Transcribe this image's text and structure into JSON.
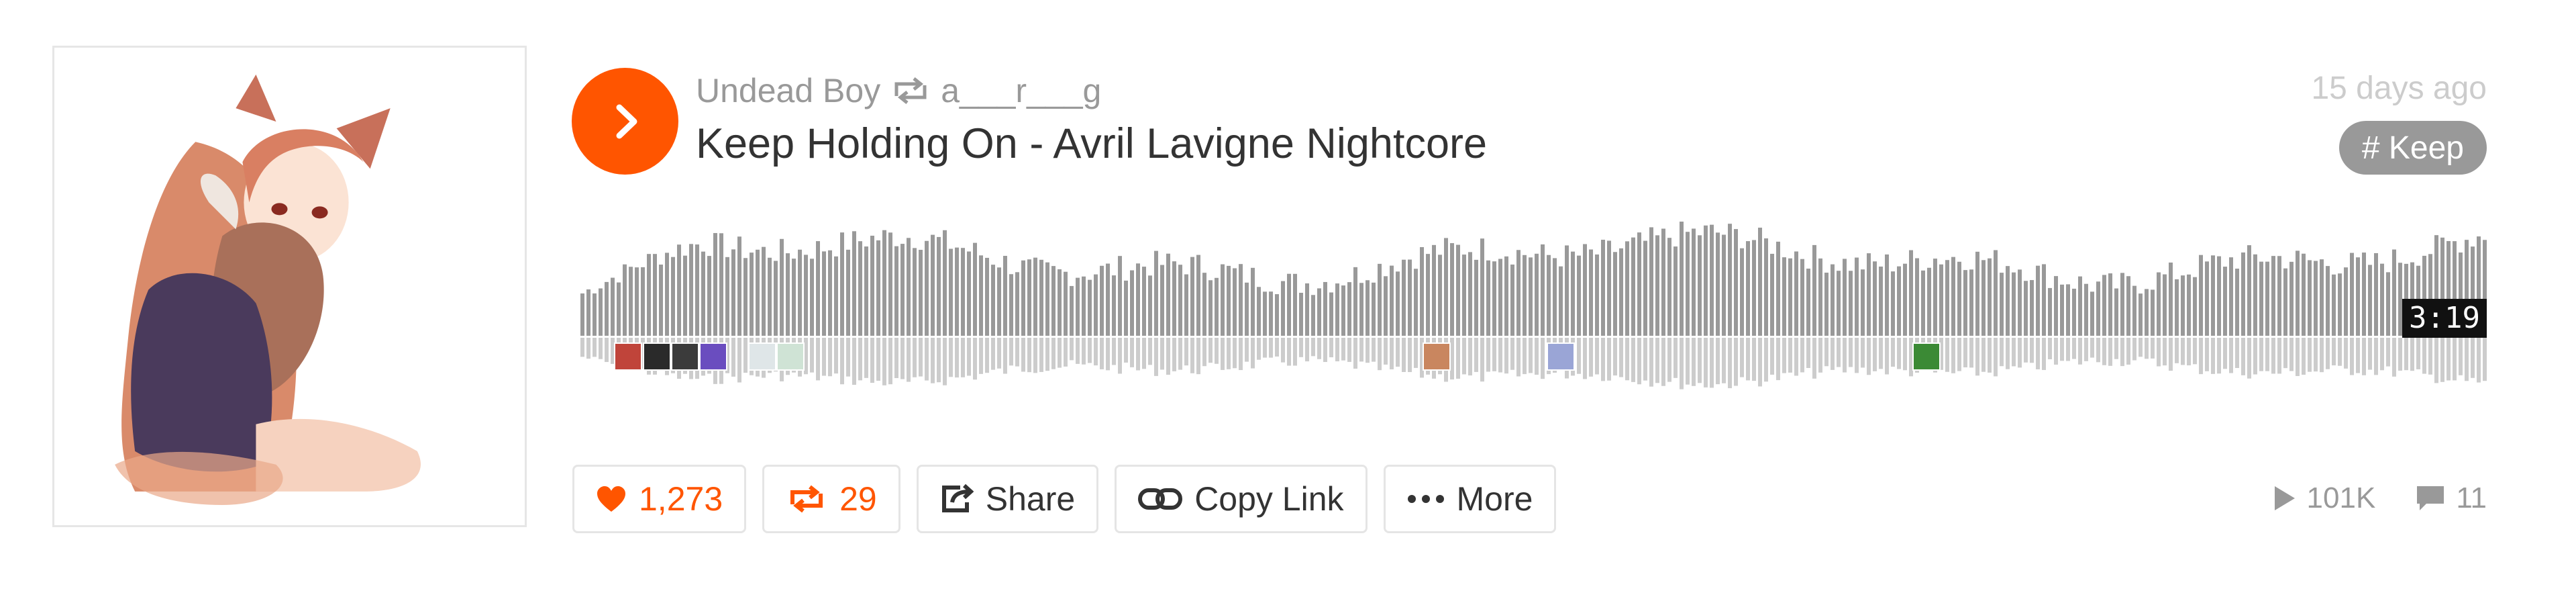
{
  "track": {
    "uploader": "Undead Boy",
    "reposted_by": "a___r___g",
    "title": "Keep Holding On - Avril Lavigne Nightcore",
    "posted": "15 days ago",
    "tag": "# Keep",
    "duration": "3:19"
  },
  "actions": {
    "like_count": "1,273",
    "repost_count": "29",
    "share_label": "Share",
    "copy_link_label": "Copy Link",
    "more_label": "More"
  },
  "stats": {
    "plays": "101K",
    "comments": "11"
  },
  "playback": {
    "played_fraction": 0
  },
  "colors": {
    "accent": "#ff5500",
    "waveform_upper": "#999999",
    "waveform_lower": "#cccccc",
    "muted_text": "#999999",
    "timestamp_text": "#cccccc"
  },
  "icons": {
    "play": "play-icon",
    "repost": "repost-icon",
    "like": "heart-icon",
    "share": "share-icon",
    "copy_link": "link-icon",
    "more": "ellipsis-icon",
    "plays": "play-count-icon",
    "comments": "comment-icon"
  }
}
